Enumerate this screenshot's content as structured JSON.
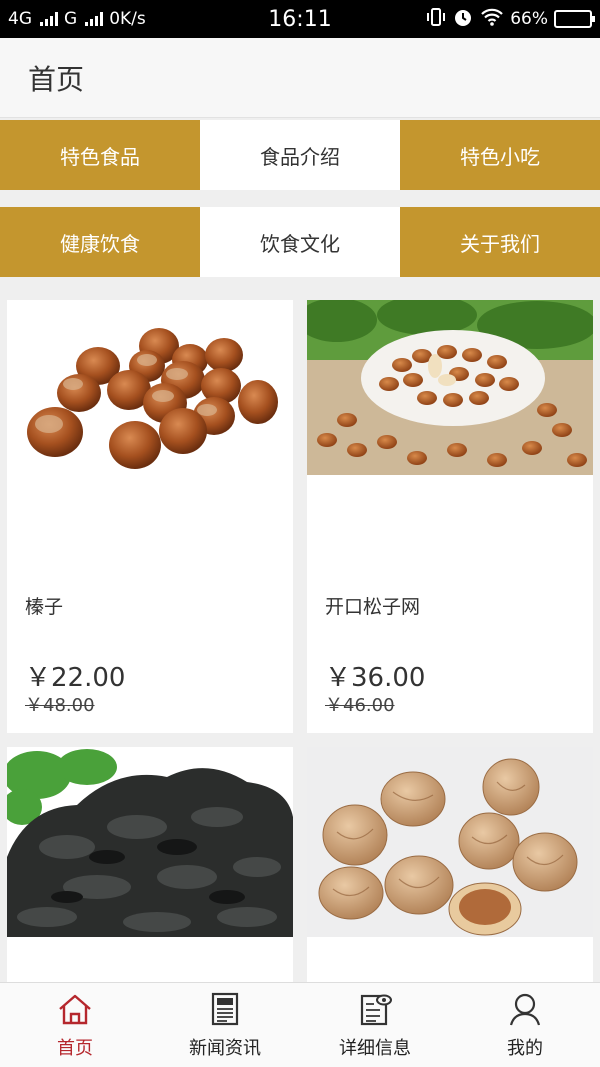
{
  "status_bar": {
    "network1": "4G",
    "network2": "G",
    "speed": "0K/s",
    "time": "16:11",
    "battery": "66%",
    "battery_level": 0.66
  },
  "header": {
    "title": "首页"
  },
  "categories": [
    {
      "label": "特色食品"
    },
    {
      "label": "食品介绍"
    },
    {
      "label": "特色小吃"
    },
    {
      "label": "健康饮食"
    },
    {
      "label": "饮食文化"
    },
    {
      "label": "关于我们"
    }
  ],
  "products": [
    {
      "name": "榛子",
      "price": "￥22.00",
      "original_price": "￥48.00",
      "image": "hazelnuts"
    },
    {
      "name": "开口松子网",
      "price": "￥36.00",
      "original_price": "￥46.00",
      "image": "pine-nuts"
    },
    {
      "image": "black-fungus"
    },
    {
      "image": "walnuts"
    }
  ],
  "bottom_nav": [
    {
      "label": "首页",
      "icon": "home-icon",
      "active": true
    },
    {
      "label": "新闻资讯",
      "icon": "news-icon"
    },
    {
      "label": "详细信息",
      "icon": "details-icon"
    },
    {
      "label": "我的",
      "icon": "profile-icon"
    }
  ],
  "colors": {
    "accent": "#c4962e",
    "active_nav": "#b5272d",
    "status_bar": "#000000"
  }
}
